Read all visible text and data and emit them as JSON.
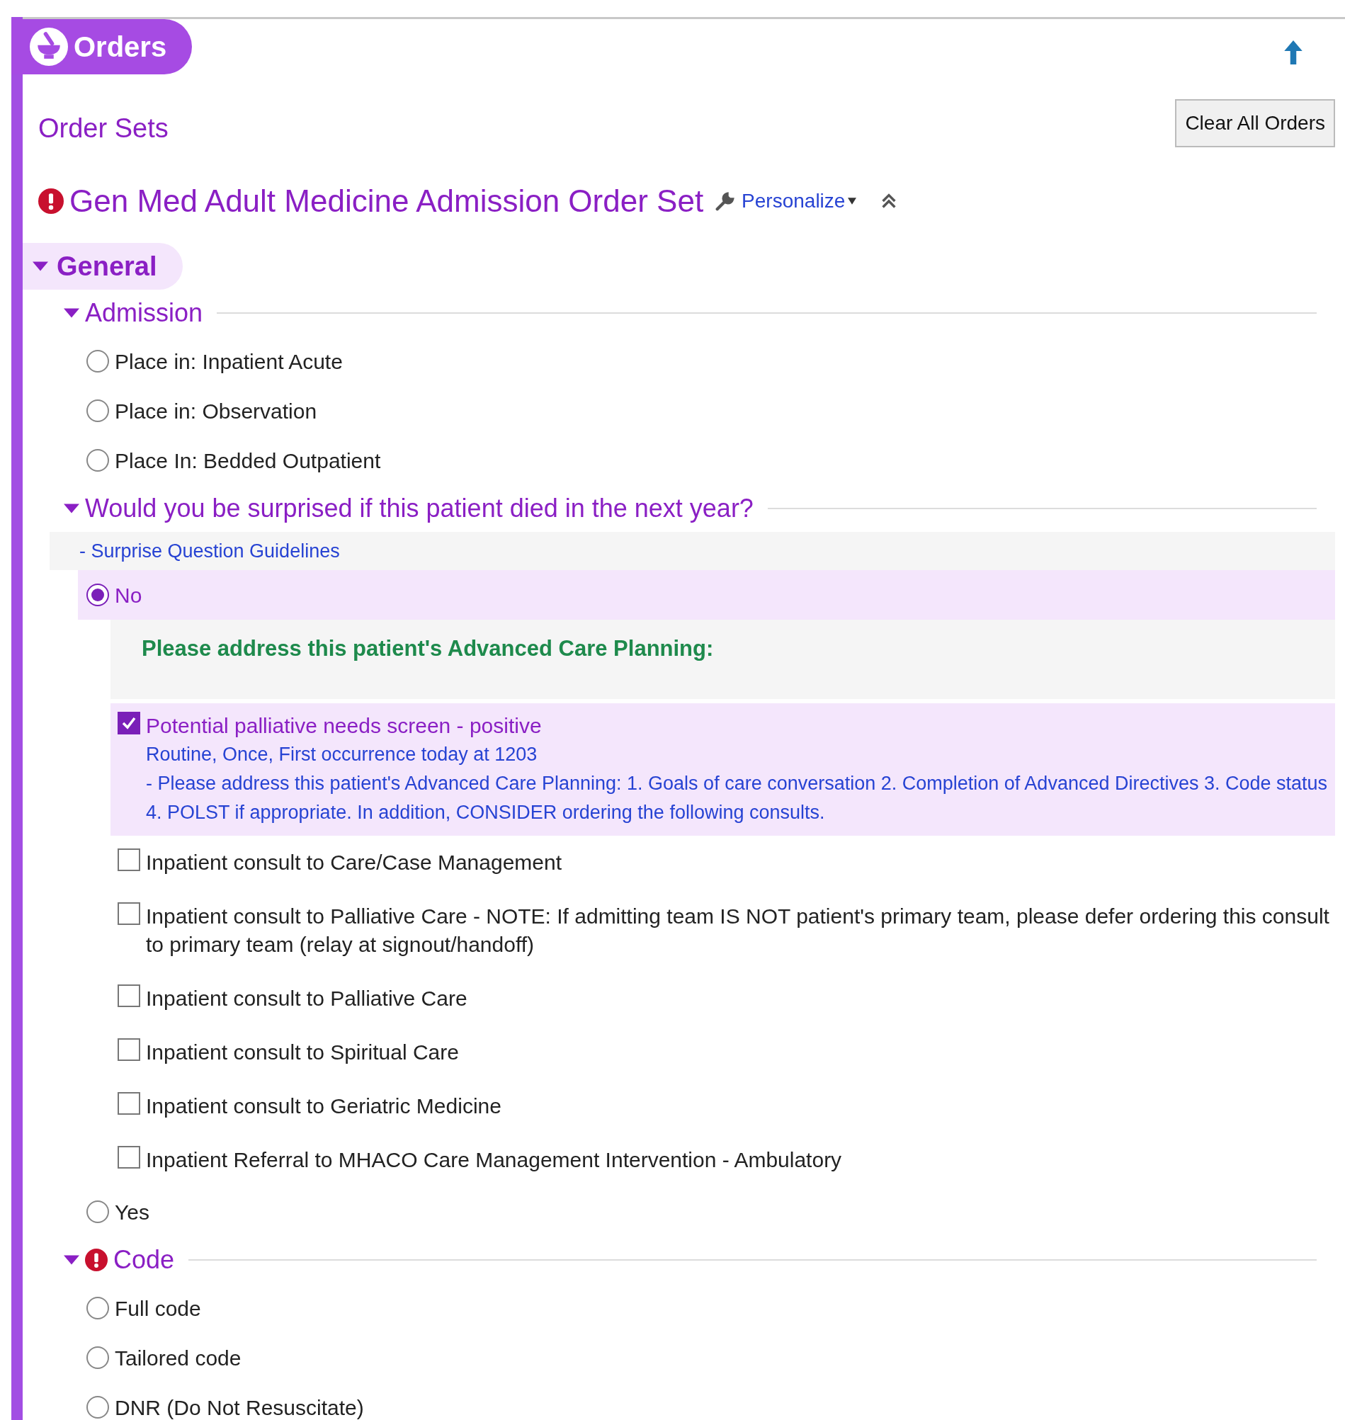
{
  "header": {
    "title": "Orders"
  },
  "order_sets_label": "Order Sets",
  "clear_button": "Clear All Orders",
  "order_set": {
    "title": "Gen Med Adult Medicine Admission Order Set",
    "required": true,
    "personalize": "Personalize",
    "expanded": true
  },
  "groups": [
    {
      "title": "General",
      "expanded": true,
      "sections": [
        {
          "title": "Admission",
          "expanded": true,
          "required": false,
          "options": [
            {
              "label": "Place in: Inpatient Acute",
              "selected": false
            },
            {
              "label": "Place in: Observation",
              "selected": false
            },
            {
              "label": "Place In: Bedded Outpatient",
              "selected": false
            }
          ]
        },
        {
          "title": "Would you be surprised if this patient died in the next year?",
          "expanded": true,
          "required": false,
          "guideline": "- Surprise Question Guidelines",
          "options": [
            {
              "label": "No",
              "selected": true,
              "note": "Please address this patient's Advanced Care Planning:",
              "orders": [
                {
                  "label": "Potential palliative needs screen - positive",
                  "checked": true,
                  "details": [
                    "Routine, Once, First occurrence today at 1203",
                    "- Please address this patient's Advanced Care Planning: 1.  Goals of care conversation 2.  Completion of Advanced Directives 3.  Code status 4.  POLST if appropriate.   In addition, CONSIDER ordering the following consults."
                  ]
                },
                {
                  "label": "Inpatient consult to Care/Case Management",
                  "checked": false
                },
                {
                  "label": "Inpatient consult to Palliative Care - NOTE:  If admitting team IS NOT patient's primary team, please defer ordering this consult to primary team (relay at signout/handoff)",
                  "checked": false
                },
                {
                  "label": "Inpatient consult to Palliative Care",
                  "checked": false
                },
                {
                  "label": "Inpatient consult to Spiritual Care",
                  "checked": false
                },
                {
                  "label": "Inpatient consult to Geriatric Medicine",
                  "checked": false
                },
                {
                  "label": "Inpatient Referral to MHACO Care Management Intervention - Ambulatory",
                  "checked": false
                }
              ]
            },
            {
              "label": "Yes",
              "selected": false
            }
          ]
        },
        {
          "title": "Code",
          "expanded": true,
          "required": true,
          "options": [
            {
              "label": "Full code",
              "selected": false
            },
            {
              "label": "Tailored code",
              "selected": false
            },
            {
              "label": "DNR (Do Not Resuscitate)",
              "selected": false
            }
          ]
        }
      ]
    }
  ]
}
